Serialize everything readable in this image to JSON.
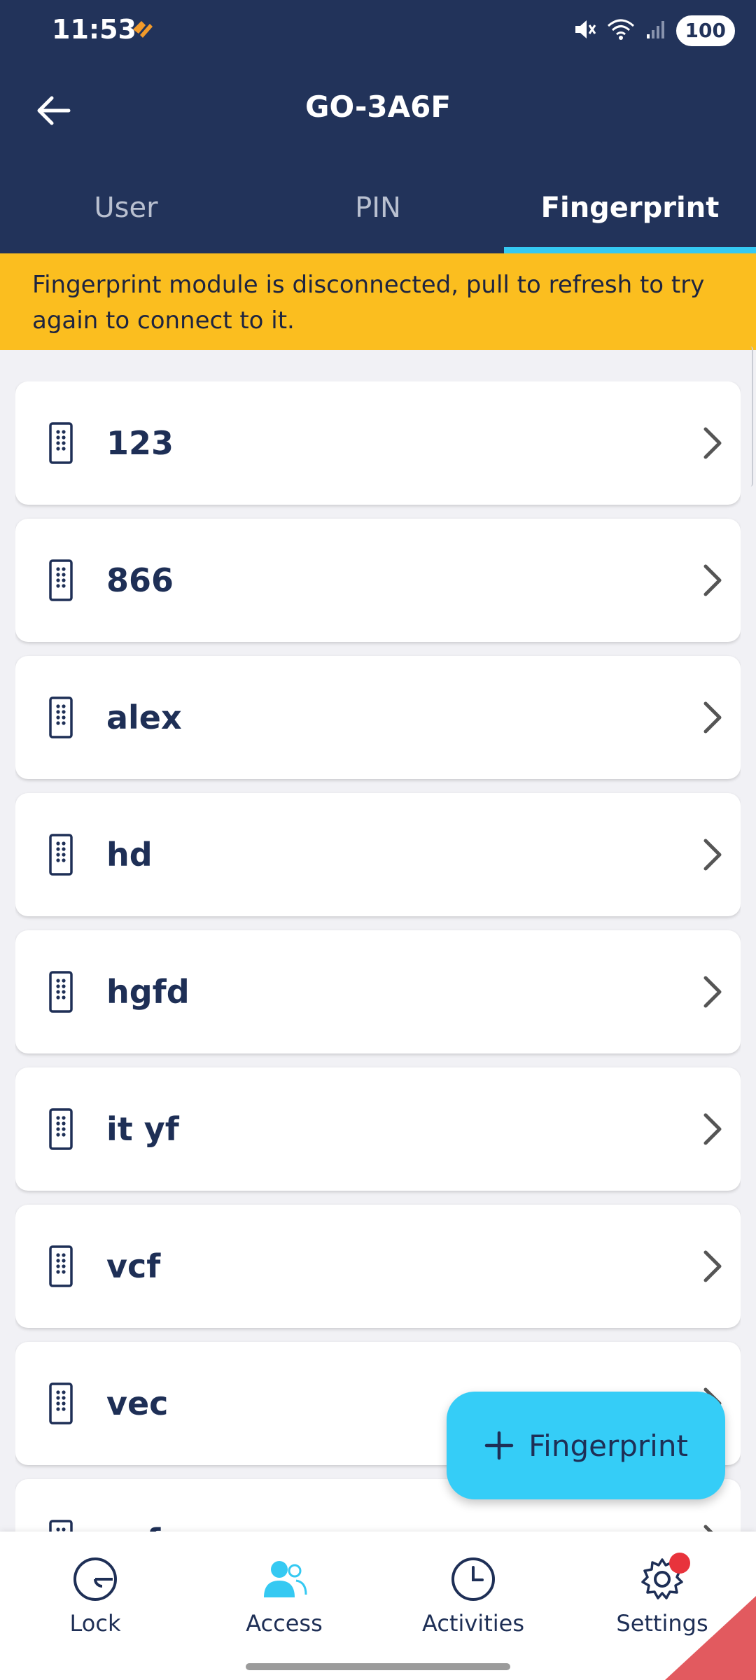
{
  "status_bar": {
    "time": "11:53",
    "battery": "100"
  },
  "header": {
    "title": "GO-3A6F"
  },
  "tabs": [
    {
      "label": "User",
      "active": false
    },
    {
      "label": "PIN",
      "active": false
    },
    {
      "label": "Fingerprint",
      "active": true
    }
  ],
  "banner": {
    "text": "Fingerprint module is disconnected, pull to refresh to try again to connect to it."
  },
  "items": [
    {
      "label": "123"
    },
    {
      "label": "866"
    },
    {
      "label": "alex"
    },
    {
      "label": "hd"
    },
    {
      "label": "hgfd"
    },
    {
      "label": "it yf"
    },
    {
      "label": "vcf"
    },
    {
      "label": "vec"
    },
    {
      "label": "vcf"
    }
  ],
  "fab": {
    "label": "Fingerprint"
  },
  "bottom_nav": [
    {
      "label": "Lock",
      "icon": "lock-dial-icon"
    },
    {
      "label": "Access",
      "icon": "users-icon",
      "active": true
    },
    {
      "label": "Activities",
      "icon": "clock-icon"
    },
    {
      "label": "Settings",
      "icon": "gear-icon",
      "badge": true
    }
  ],
  "colors": {
    "header_bg": "#22335a",
    "accent": "#35c9f2",
    "banner_bg": "#fbbe1f",
    "badge": "#e8333c"
  }
}
